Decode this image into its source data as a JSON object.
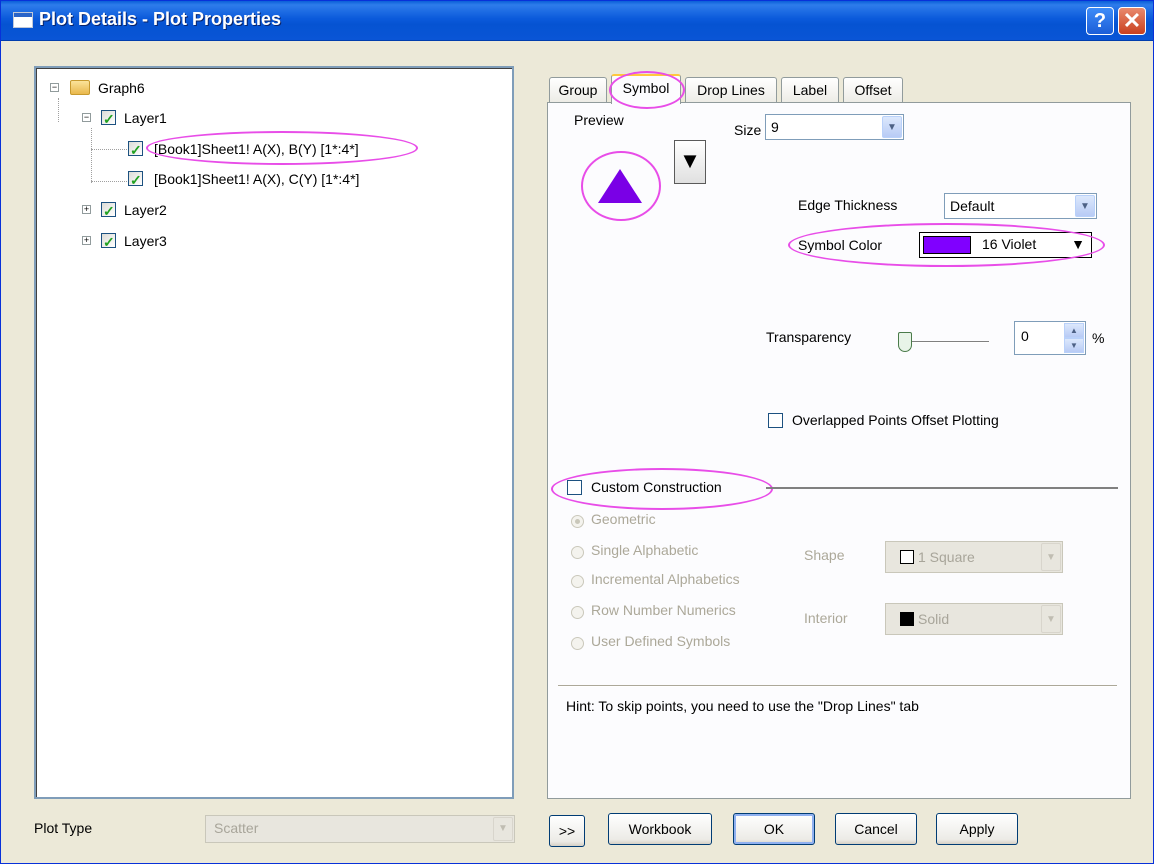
{
  "window": {
    "title": "Plot Details - Plot Properties",
    "help_label": "?",
    "close_label": "✕"
  },
  "tree": {
    "root": "Graph6",
    "layer1": "Layer1",
    "plot1": "[Book1]Sheet1! A(X), B(Y) [1*:4*]",
    "plot2": "[Book1]Sheet1! A(X), C(Y) [1*:4*]",
    "layer2": "Layer2",
    "layer3": "Layer3"
  },
  "tabs": [
    "Group",
    "Symbol",
    "Drop Lines",
    "Label",
    "Offset"
  ],
  "symbol": {
    "preview_label": "Preview",
    "size_label": "Size",
    "size_value": "9",
    "preview_dropdown_glyph": "▼",
    "edge_thickness_label": "Edge Thickness",
    "edge_thickness_value": "Default",
    "symbol_color_label": "Symbol Color",
    "symbol_color_value": "16 Violet",
    "symbol_color_hex": "#8000FF",
    "transparency_label": "Transparency",
    "transparency_value": "0",
    "transparency_unit": "%",
    "overlapped_label": "Overlapped Points Offset Plotting",
    "custom_construction_label": "Custom Construction",
    "geometric_label": "Geometric",
    "single_alpha_label": "Single Alphabetic",
    "incremental_alpha_label": "Incremental Alphabetics",
    "row_number_label": "Row Number Numerics",
    "user_defined_label": "User Defined Symbols",
    "shape_label": "Shape",
    "shape_value": "1 Square",
    "interior_label": "Interior",
    "interior_value": "Solid",
    "hint": "Hint: To skip points, you need to use the \"Drop Lines\" tab"
  },
  "bottom": {
    "plot_type_label": "Plot Type",
    "plot_type_value": "Scatter",
    "expand_label": ">>",
    "workbook_label": "Workbook",
    "ok_label": "OK",
    "cancel_label": "Cancel",
    "apply_label": "Apply"
  },
  "colors": {
    "highlight": "#E84DE8",
    "symbol_color": "#7A00E6"
  }
}
